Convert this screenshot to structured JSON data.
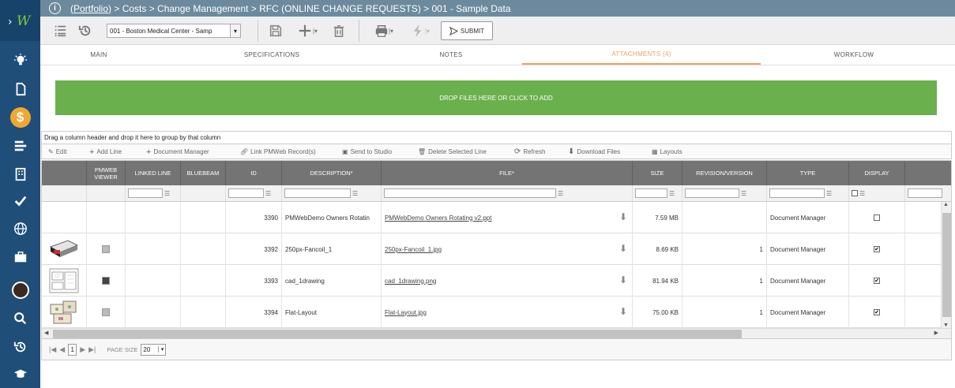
{
  "breadcrumb": {
    "portfolio": "(Portfolio)",
    "rest": " > Costs > Change Management > RFC (ONLINE CHANGE REQUESTS) > 001 - Sample Data"
  },
  "toolbar": {
    "project_select": "001 - Boston Medical Center - Samp",
    "submit_label": "SUBMIT"
  },
  "tabs": [
    "MAIN",
    "SPECIFICATIONS",
    "NOTES",
    "ATTACHMENTS (4)",
    "WORKFLOW"
  ],
  "dropzone": {
    "label": "DROP FILES HERE OR CLICK TO ADD"
  },
  "group_hint": "Drag a column header and drop it here to group by that column",
  "grid_tools": [
    "Edit",
    "Add Line",
    "Document Manager",
    "Link PMWeb Record(s)",
    "Send to Studio",
    "Delete Selected Line",
    "Refresh",
    "Download Files",
    "Layouts"
  ],
  "columns": {
    "viewer": "PMWEB VIEWER",
    "linked": "LINKED LINE",
    "bluebeam": "BLUEBEAM",
    "id": "ID",
    "description": "DESCRIPTION*",
    "file": "FILE*",
    "size": "SIZE",
    "revision": "REVISION/VERSION",
    "type": "TYPE",
    "display": "DISPLAY"
  },
  "rows": [
    {
      "id": "3390",
      "description": "PMWebDemo Owners Rotatin",
      "file": "PMWebDemo Owners Rotating v2.ppt",
      "size": "7.59 MB",
      "revision": "",
      "type": "Document Manager",
      "display": "",
      "thumb": "none"
    },
    {
      "id": "3392",
      "description": "250px-Fancoil_1",
      "file": "250px-Fancoil_1.jpg",
      "size": "8.69 KB",
      "revision": "1",
      "type": "Document Manager",
      "display": "✔",
      "thumb": "fancoil"
    },
    {
      "id": "3393",
      "description": "cad_1drawing",
      "file": "cad_1drawing.png",
      "size": "81.94 KB",
      "revision": "1",
      "type": "Document Manager",
      "display": "✔",
      "thumb": "cad"
    },
    {
      "id": "3394",
      "description": "Flat-Layout",
      "file": "Flat-Layout.jpg",
      "size": "75.00 KB",
      "revision": "1",
      "type": "Document Manager",
      "display": "✔",
      "thumb": "layout"
    }
  ],
  "pager": {
    "page": "1",
    "page_size_label": "PAGE SIZE",
    "page_size": "20"
  },
  "colors": {
    "sidebar": "#1f4e79",
    "topbar": "#6b8a9e",
    "dropzone": "#6ab04c",
    "active_tab": "#f0a060",
    "active_nav": "#f0a830"
  }
}
